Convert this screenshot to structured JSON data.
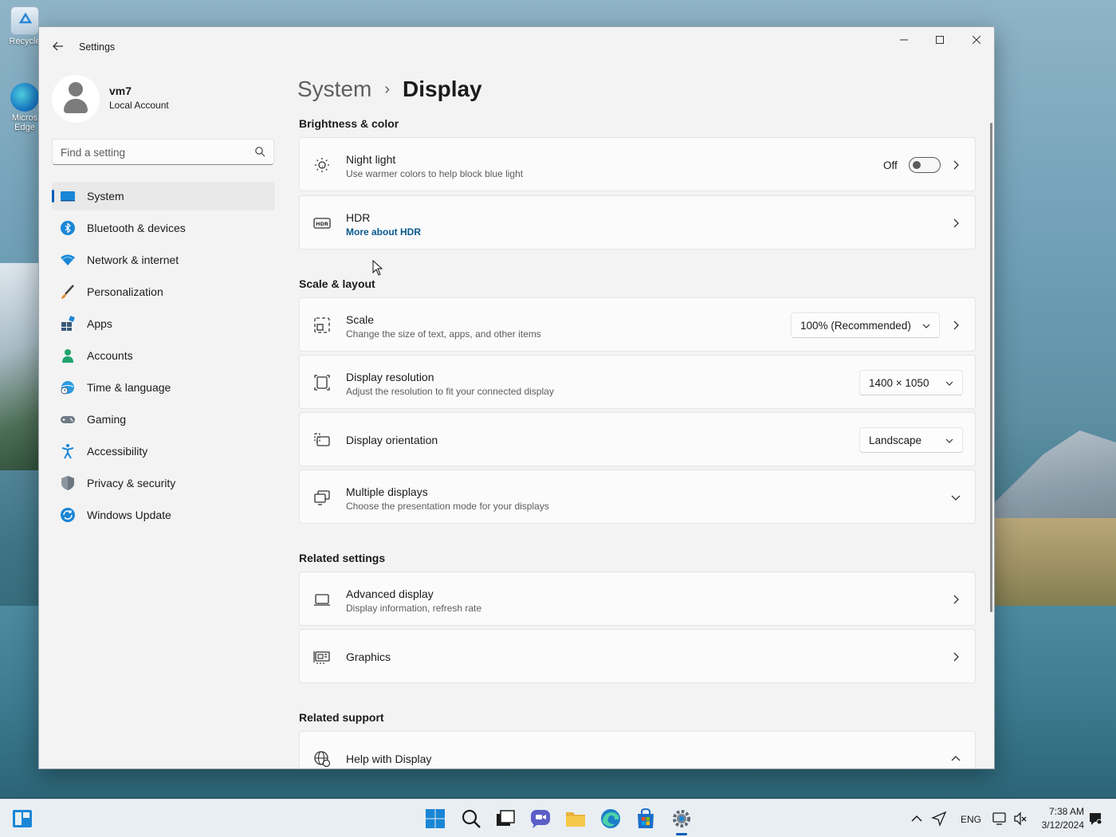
{
  "desktop": {
    "icons": [
      {
        "name": "recycle-bin",
        "label": "Recycle"
      },
      {
        "name": "microsoft-edge",
        "label": "Micros Edge"
      }
    ]
  },
  "window": {
    "title": "Settings",
    "controls": [
      "minimize",
      "maximize",
      "close"
    ]
  },
  "profile": {
    "name": "vm7",
    "account_type": "Local Account"
  },
  "search": {
    "placeholder": "Find a setting"
  },
  "nav": {
    "items": [
      {
        "label": "System",
        "icon": "system-icon",
        "active": true
      },
      {
        "label": "Bluetooth & devices",
        "icon": "bluetooth-icon"
      },
      {
        "label": "Network & internet",
        "icon": "wifi-icon"
      },
      {
        "label": "Personalization",
        "icon": "brush-icon"
      },
      {
        "label": "Apps",
        "icon": "apps-icon"
      },
      {
        "label": "Accounts",
        "icon": "person-icon"
      },
      {
        "label": "Time & language",
        "icon": "globe-clock-icon"
      },
      {
        "label": "Gaming",
        "icon": "gamepad-icon"
      },
      {
        "label": "Accessibility",
        "icon": "accessibility-icon"
      },
      {
        "label": "Privacy & security",
        "icon": "shield-icon"
      },
      {
        "label": "Windows Update",
        "icon": "update-icon"
      }
    ]
  },
  "breadcrumb": {
    "parent": "System",
    "separator": "›",
    "current": "Display"
  },
  "sections": {
    "brightness": {
      "title": "Brightness & color",
      "night_light": {
        "title": "Night light",
        "subtitle": "Use warmer colors to help block blue light",
        "state_label": "Off",
        "enabled": false
      },
      "hdr": {
        "title": "HDR",
        "link": "More about HDR"
      }
    },
    "scale_layout": {
      "title": "Scale & layout",
      "scale": {
        "title": "Scale",
        "subtitle": "Change the size of text, apps, and other items",
        "value": "100% (Recommended)"
      },
      "resolution": {
        "title": "Display resolution",
        "subtitle": "Adjust the resolution to fit your connected display",
        "value": "1400 × 1050"
      },
      "orientation": {
        "title": "Display orientation",
        "value": "Landscape"
      },
      "multiple": {
        "title": "Multiple displays",
        "subtitle": "Choose the presentation mode for your displays"
      }
    },
    "related_settings": {
      "title": "Related settings",
      "advanced": {
        "title": "Advanced display",
        "subtitle": "Display information, refresh rate"
      },
      "graphics": {
        "title": "Graphics"
      }
    },
    "related_support": {
      "title": "Related support",
      "help": {
        "title": "Help with Display"
      }
    }
  },
  "taskbar": {
    "apps": [
      "start",
      "search",
      "task-view",
      "chat",
      "file-explorer",
      "edge",
      "store",
      "settings"
    ],
    "language": "ENG",
    "time": "7:38 AM",
    "date": "3/12/2024"
  },
  "colors": {
    "accent": "#005fb8",
    "window_bg": "#f3f3f3",
    "card_bg": "#fbfbfb",
    "taskbar_bg": "#e9eef3"
  }
}
